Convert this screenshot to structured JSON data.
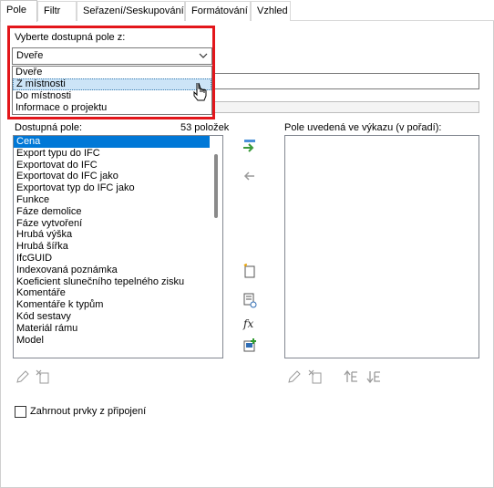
{
  "tabs": [
    {
      "label": "Pole",
      "active": true
    },
    {
      "label": "Filtr",
      "active": false
    },
    {
      "label": "Seřazení/Seskupování",
      "active": false
    },
    {
      "label": "Formátování",
      "active": false
    },
    {
      "label": "Vzhled",
      "active": false
    }
  ],
  "select_from": {
    "label": "Vyberte dostupná pole z:",
    "value": "Dveře",
    "options": [
      "Dveře",
      "Z místnosti",
      "Do místnosti",
      "Informace o projektu"
    ],
    "highlighted_option": "Z místnosti"
  },
  "available": {
    "label": "Dostupná pole:",
    "count": "53 položek",
    "items": [
      "Cena",
      "Export typu do IFC",
      "Exportovat do IFC",
      "Exportovat do IFC jako",
      "Exportovat typ do IFC jako",
      "Funkce",
      "Fáze demolice",
      "Fáze vytvoření",
      "Hrubá výška",
      "Hrubá šířka",
      "IfcGUID",
      "Indexovaná poznámka",
      "Koeficient slunečního tepelného zisku",
      "Komentáře",
      "Komentáře k typům",
      "Kód sestavy",
      "Materiál rámu",
      "Model"
    ],
    "selected": "Cena"
  },
  "scheduled": {
    "label": "Pole uvedená ve výkazu (v pořadí):"
  },
  "include_linked": {
    "label": "Zahrnout prvky z připojení",
    "checked": false
  },
  "icons": {
    "add": "add-field-icon",
    "remove": "remove-field-icon",
    "new_param": "new-parameter-icon",
    "combine": "combine-parameters-icon",
    "formula": "formula-icon",
    "add_calc": "calculated-value-icon",
    "edit": "edit-icon",
    "delete": "delete-icon",
    "move_up": "move-up-icon",
    "move_down": "move-down-icon"
  },
  "colors": {
    "highlight_red": "#e3161b",
    "selection_blue": "#0078d7",
    "hover_blue": "#cce4f7"
  }
}
